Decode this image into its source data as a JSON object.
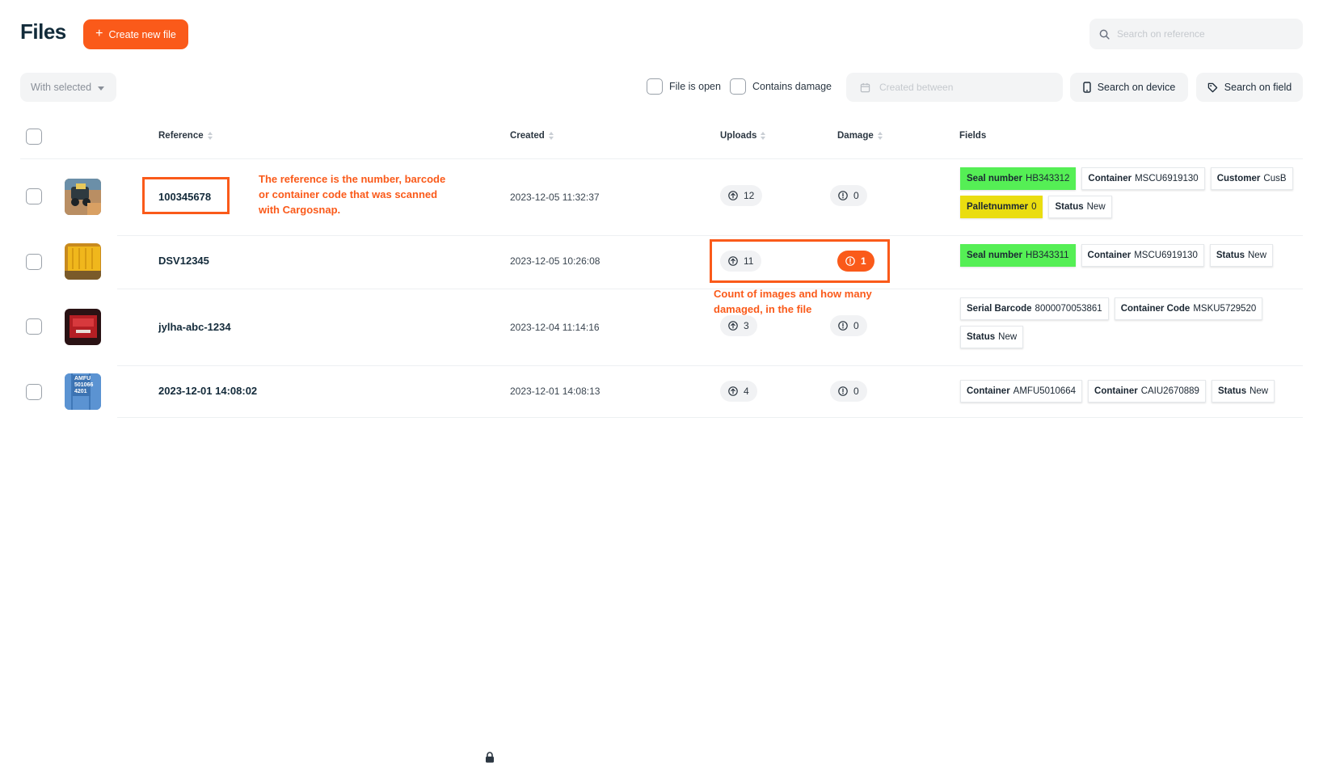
{
  "header": {
    "title": "Files",
    "create_label": "Create new file",
    "search_placeholder": "Search on reference"
  },
  "toolbar": {
    "with_selected_label": "With selected",
    "file_is_open_label": "File is open",
    "contains_damage_label": "Contains damage",
    "created_between_placeholder": "Created between",
    "search_device_label": "Search on device",
    "search_field_label": "Search on field"
  },
  "table": {
    "columns": {
      "reference": "Reference",
      "created": "Created",
      "uploads": "Uploads",
      "damage": "Damage",
      "fields": "Fields"
    },
    "rows": [
      {
        "reference": "100345678",
        "created": "2023-12-05 11:32:37",
        "uploads": "12",
        "damage": "0",
        "fields": [
          {
            "key": "Seal number",
            "value": "HB343312",
            "color": "#55ef55"
          },
          {
            "key": "Container",
            "value": "MSCU6919130"
          },
          {
            "key": "Customer",
            "value": "CusB"
          },
          {
            "key": "Palletnummer",
            "value": "0",
            "color": "#eadd10"
          },
          {
            "key": "Status",
            "value": "New"
          }
        ]
      },
      {
        "reference": "DSV12345",
        "created": "2023-12-05 10:26:08",
        "uploads": "11",
        "damage": "1",
        "fields": [
          {
            "key": "Seal number",
            "value": "HB343311",
            "color": "#55ef55"
          },
          {
            "key": "Container",
            "value": "MSCU6919130"
          },
          {
            "key": "Status",
            "value": "New"
          }
        ]
      },
      {
        "reference": "jylha-abc-1234",
        "created": "2023-12-04 11:14:16",
        "uploads": "3",
        "damage": "0",
        "fields": [
          {
            "key": "Serial Barcode",
            "value": "8000070053861"
          },
          {
            "key": "Container Code",
            "value": "MSKU5729520"
          },
          {
            "key": "Status",
            "value": "New"
          }
        ]
      },
      {
        "reference": "2023-12-01 14:08:02",
        "created": "2023-12-01 14:08:13",
        "uploads": "4",
        "damage": "0",
        "locked": true,
        "thumb_text": "AMFU 501066 4201",
        "fields": [
          {
            "key": "Container",
            "value": "AMFU5010664"
          },
          {
            "key": "Container",
            "value": "CAIU2670889"
          },
          {
            "key": "Status",
            "value": "New"
          }
        ]
      }
    ]
  },
  "annotations": {
    "reference_note": "The reference is the number, barcode\nor container code that was scanned\nwith Cargosnap.",
    "count_note": "Count of images and how many\ndamaged, in the file"
  },
  "colors": {
    "accent": "#fa5a1a",
    "green_tag": "#55ef55",
    "yellow_tag": "#eadd10"
  }
}
